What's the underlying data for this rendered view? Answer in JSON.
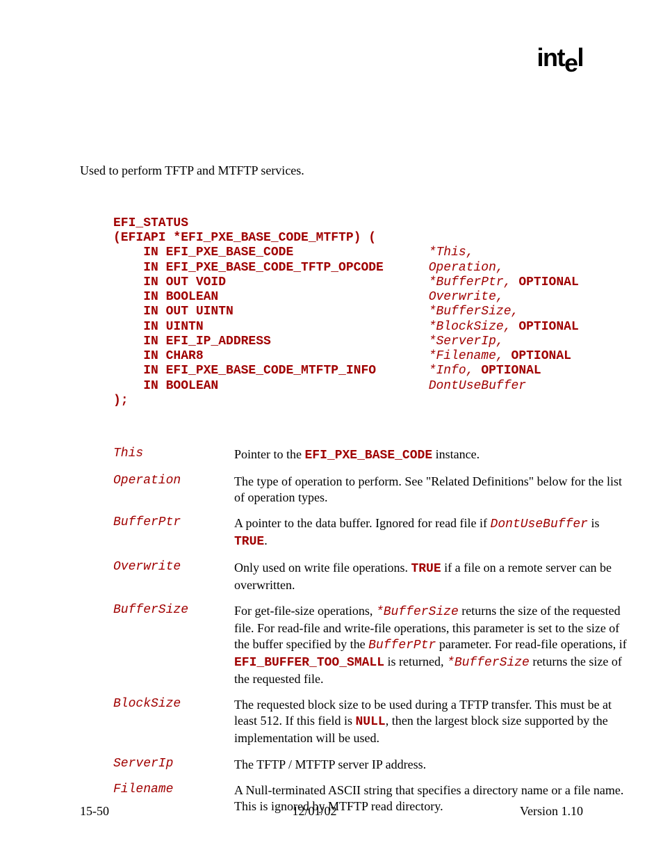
{
  "logo": "intel",
  "summary": "Used to perform TFTP and MTFTP services.",
  "prototype": {
    "return_type": "EFI_STATUS",
    "signature_open": "(EFIAPI *EFI_PXE_BASE_CODE_MTFTP) (",
    "signature_close": ");",
    "params": [
      {
        "dir": "IN",
        "type": "EFI_PXE_BASE_CODE",
        "name": "*This",
        "trail": ","
      },
      {
        "dir": "IN",
        "type": "EFI_PXE_BASE_CODE_TFTP_OPCODE",
        "name": "Operation",
        "trail": ","
      },
      {
        "dir": "IN OUT",
        "type": "VOID",
        "name": "*BufferPtr",
        "trail": ",",
        "optional": "OPTIONAL"
      },
      {
        "dir": "IN",
        "type": "BOOLEAN",
        "name": "Overwrite",
        "trail": ","
      },
      {
        "dir": "IN OUT",
        "type": "UINTN",
        "name": "*BufferSize",
        "trail": ","
      },
      {
        "dir": "IN",
        "type": "UINTN",
        "name": "*BlockSize",
        "trail": ",",
        "optional": "OPTIONAL"
      },
      {
        "dir": "IN",
        "type": "EFI_IP_ADDRESS",
        "name": "*ServerIp",
        "trail": ","
      },
      {
        "dir": "IN",
        "type": "CHAR8",
        "name": "*Filename",
        "trail": ",",
        "optional": "OPTIONAL"
      },
      {
        "dir": "IN",
        "type": "EFI_PXE_BASE_CODE_MTFTP_INFO",
        "name": "*Info",
        "trail": ",",
        "optional": "OPTIONAL"
      },
      {
        "dir": "IN",
        "type": "BOOLEAN",
        "name": "DontUseBuffer",
        "trail": ""
      }
    ]
  },
  "param_docs": [
    {
      "name": "This",
      "desc": [
        {
          "t": "Pointer to the "
        },
        {
          "t": "EFI_PXE_BASE_CODE",
          "c": "code"
        },
        {
          "t": " instance."
        }
      ]
    },
    {
      "name": "Operation",
      "desc": [
        {
          "t": "The type of operation to perform.  See \"Related Definitions\" below for the list of operation types."
        }
      ]
    },
    {
      "name": "BufferPtr",
      "desc": [
        {
          "t": "A pointer to the data buffer.  Ignored for read file if "
        },
        {
          "t": "DontUseBuffer",
          "c": "code-italic"
        },
        {
          "t": " is "
        },
        {
          "t": "TRUE",
          "c": "code"
        },
        {
          "t": "."
        }
      ]
    },
    {
      "name": "Overwrite",
      "desc": [
        {
          "t": "Only used on write file operations.  "
        },
        {
          "t": "TRUE",
          "c": "code"
        },
        {
          "t": " if a file on a remote server can be overwritten."
        }
      ]
    },
    {
      "name": "BufferSize",
      "desc": [
        {
          "t": "For get-file-size operations, "
        },
        {
          "t": "*BufferSize",
          "c": "code-italic"
        },
        {
          "t": " returns the size of the requested file.  For read-file and write-file operations, this parameter is set to the size of the buffer specified by the "
        },
        {
          "t": "BufferPtr",
          "c": "code-italic"
        },
        {
          "t": " parameter.  For read-file operations, if "
        },
        {
          "t": "EFI_BUFFER_TOO_SMALL",
          "c": "code"
        },
        {
          "t": " is returned, "
        },
        {
          "t": "*BufferSize",
          "c": "code-italic"
        },
        {
          "t": " returns the size of the requested file."
        }
      ]
    },
    {
      "name": "BlockSize",
      "desc": [
        {
          "t": "The requested block size to be used during a TFTP transfer.  This must be at least 512.  If this field is "
        },
        {
          "t": "NULL",
          "c": "code"
        },
        {
          "t": ", then the largest block size supported by the implementation will be used."
        }
      ]
    },
    {
      "name": "ServerIp",
      "desc": [
        {
          "t": "The TFTP / MTFTP server IP address."
        }
      ]
    },
    {
      "name": "Filename",
      "desc": [
        {
          "t": "A Null-terminated ASCII string that specifies a directory name or a file name.  This is ignored by MTFTP read directory."
        }
      ]
    }
  ],
  "footer": {
    "left": "15-50",
    "center": "12/01/02",
    "right": "Version 1.10"
  }
}
